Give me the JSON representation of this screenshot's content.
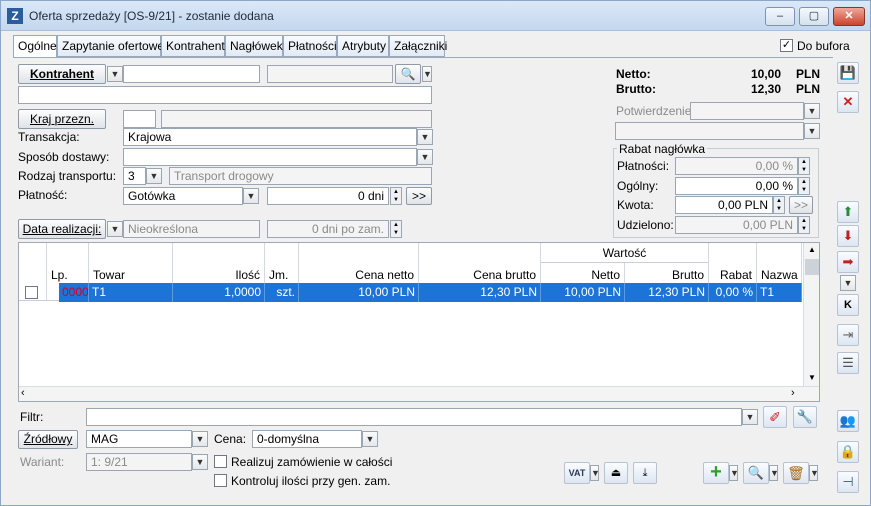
{
  "window": {
    "title": "Oferta sprzedaży [OS-9/21] - zostanie dodana",
    "app_icon": "Z",
    "min": "–",
    "max": "▢",
    "close": "✕"
  },
  "tabs": [
    "Ogólne",
    "Zapytanie ofertowe",
    "Kontrahent",
    "Nagłówek",
    "Płatności",
    "Atrybuty",
    "Załączniki"
  ],
  "do_bufora": {
    "label": "Do bufora",
    "checked": "✓"
  },
  "form": {
    "kontrahent_label": "Kontrahent",
    "kraj_label": "Kraj przezn.",
    "transakcja_label": "Transakcja:",
    "transakcja_value": "Krajowa",
    "sposob_label": "Sposób dostawy:",
    "rodzaj_label": "Rodzaj transportu:",
    "rodzaj_code": "3",
    "rodzaj_value": "Transport drogowy",
    "platnosc_label": "Płatność:",
    "platnosc_value": "Gotówka",
    "platnosc_days": "0 dni",
    "platnosc_btn": ">>",
    "data_label": "Data realizacji:",
    "data_value": "Nieokreślona",
    "data_days": "0 dni po zam."
  },
  "totals": {
    "netto_label": "Netto:",
    "netto_value": "10,00",
    "brutto_label": "Brutto:",
    "brutto_value": "12,30",
    "currency": "PLN",
    "potwierdzenie_label": "Potwierdzenie:"
  },
  "rabat": {
    "title": "Rabat nagłówka",
    "platnosci_label": "Płatności:",
    "platnosci_value": "0,00 %",
    "ogolny_label": "Ogólny:",
    "ogolny_value": "0,00 %",
    "kwota_label": "Kwota:",
    "kwota_value": "0,00 PLN",
    "kwota_btn": ">>",
    "udzielono_label": "Udzielono:",
    "udzielono_value": "0,00 PLN"
  },
  "table": {
    "headers": {
      "lp": "Lp.",
      "towar": "Towar",
      "ilosc": "Ilość",
      "jm": "Jm.",
      "cena_netto": "Cena netto",
      "cena_brutto": "Cena brutto",
      "wartosc": "Wartość",
      "netto": "Netto",
      "brutto": "Brutto",
      "rabat": "Rabat",
      "nazwa": "Nazwa"
    },
    "row": {
      "lp": "00001",
      "towar": "T1",
      "ilosc": "1,0000",
      "jm": "szt.",
      "cena_netto": "10,00 PLN",
      "cena_brutto": "12,30 PLN",
      "netto": "10,00 PLN",
      "brutto": "12,30 PLN",
      "rabat": "0,00 %",
      "nazwa": "T1"
    }
  },
  "bottom": {
    "filtr_label": "Filtr:",
    "zrodlowy_label": "Źródłowy",
    "zrodlowy_value": "MAG",
    "cena_label": "Cena:",
    "cena_value": "0-domyślna",
    "wariant_label": "Wariant:",
    "wariant_value": "1:  9/21",
    "realizuj_label": "Realizuj zamówienie w całości",
    "kontroluj_label": "Kontroluj ilości przy gen. zam.",
    "vat_label": "VAT"
  },
  "colors": {
    "selection": "#1c74d6",
    "lp_text": "#d0002b",
    "title_bg": "#c4d7ef"
  }
}
